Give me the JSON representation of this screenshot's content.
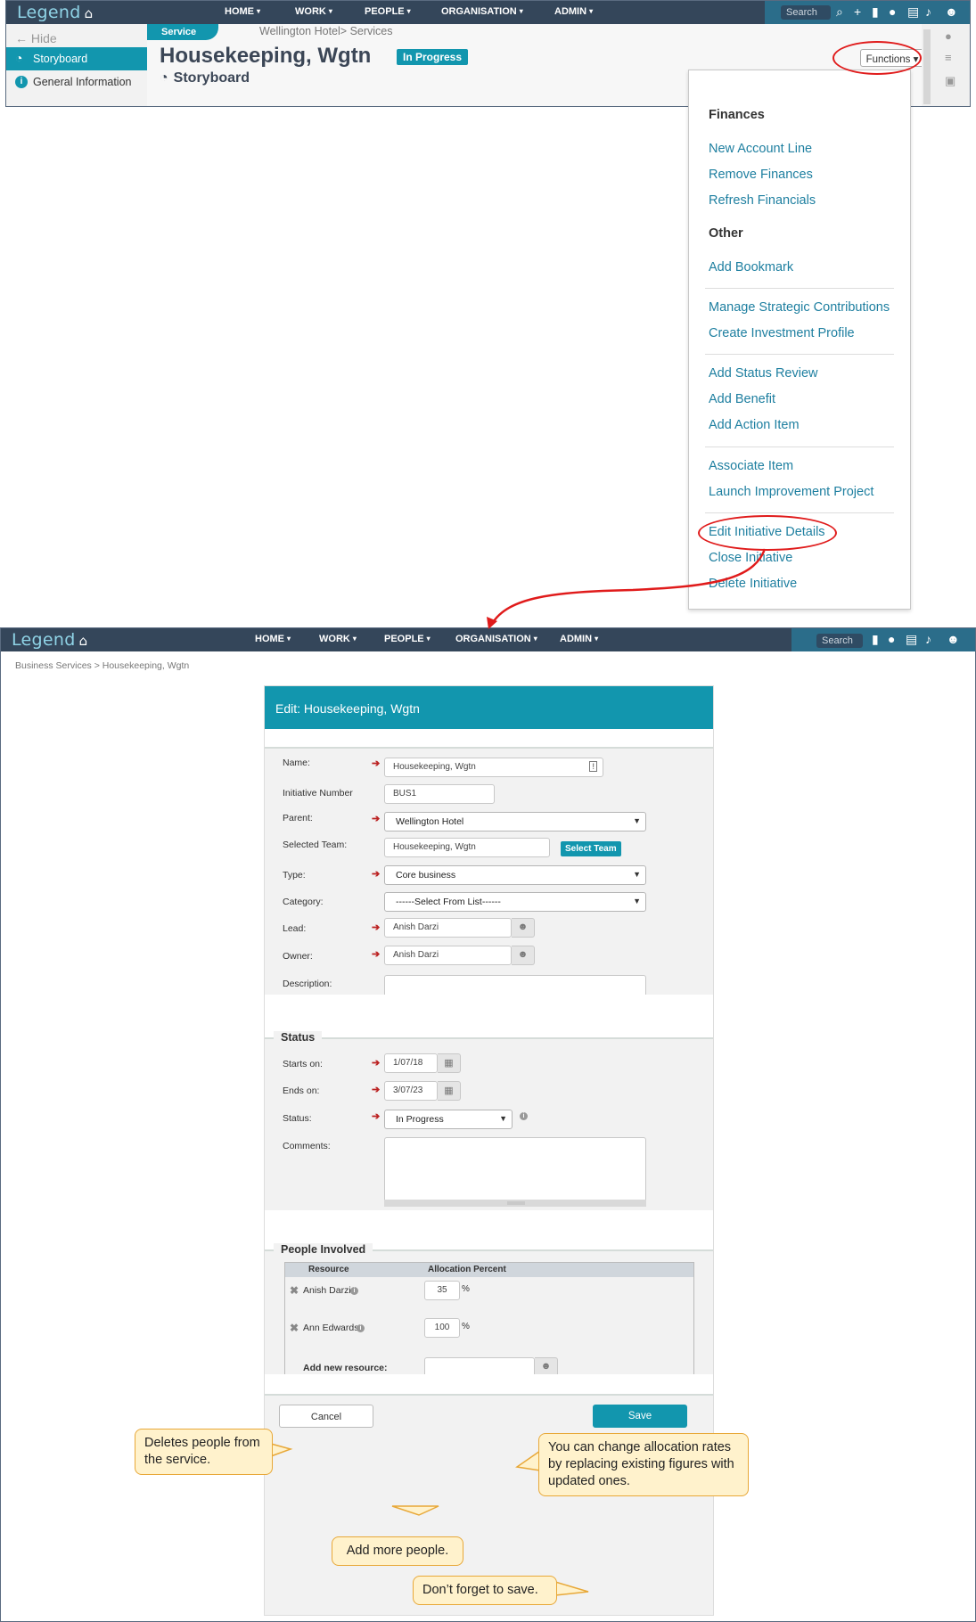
{
  "top": {
    "logo": "Legend",
    "nav": [
      "HOME",
      "WORK",
      "PEOPLE",
      "ORGANISATION",
      "ADMIN"
    ],
    "search_placeholder": "Search",
    "sidebar": {
      "hide": "Hide",
      "items": [
        "Storyboard",
        "General Information"
      ]
    },
    "service_tab": "Service",
    "breadcrumb": "Wellington Hotel> Services",
    "title": "Housekeeping, Wgtn",
    "status_badge": "In Progress",
    "subtitle": "Storyboard",
    "functions_button": "Functions"
  },
  "functions_menu": {
    "finances_heading": "Finances",
    "finances_items": [
      "New Account Line",
      "Remove Finances",
      "Refresh Financials"
    ],
    "other_heading": "Other",
    "other_items": [
      "Add Bookmark",
      "Manage Strategic Contributions",
      "Create Investment Profile",
      "Add Status Review",
      "Add Benefit",
      "Add Action Item",
      "Associate Item",
      "Launch Improvement Project",
      "Edit Initiative Details",
      "Close Initiative",
      "Delete Initiative"
    ]
  },
  "bottom": {
    "logo": "Legend",
    "nav": [
      "HOME",
      "WORK",
      "PEOPLE",
      "ORGANISATION",
      "ADMIN"
    ],
    "search_placeholder": "Search",
    "breadcrumb": "Business Services > Housekeeping, Wgtn",
    "form": {
      "header": "Edit: Housekeeping, Wgtn",
      "name_label": "Name:",
      "name_value": "Housekeeping, Wgtn",
      "number_label": "Initiative Number",
      "number_value": "BUS1",
      "parent_label": "Parent:",
      "parent_value": "Wellington Hotel",
      "team_label": "Selected Team:",
      "team_value": "Housekeeping, Wgtn",
      "select_team_button": "Select Team",
      "type_label": "Type:",
      "type_value": "Core business",
      "category_label": "Category:",
      "category_value": "------Select From List------",
      "lead_label": "Lead:",
      "lead_value": "Anish Darzi",
      "owner_label": "Owner:",
      "owner_value": "Anish Darzi",
      "description_label": "Description:",
      "status_section": "Status",
      "starts_label": "Starts on:",
      "starts_value": "1/07/18",
      "ends_label": "Ends on:",
      "ends_value": "3/07/23",
      "status_label": "Status:",
      "status_value": "In Progress",
      "comments_label": "Comments:",
      "people_section": "People Involved",
      "resource_header": "Resource",
      "allocation_header": "Allocation Percent",
      "people": [
        {
          "name": "Anish Darzi",
          "allocation": "35"
        },
        {
          "name": "Ann Edwards",
          "allocation": "100"
        }
      ],
      "percent_sign": "%",
      "add_resource_label": "Add new resource:",
      "cancel_button": "Cancel",
      "save_button": "Save"
    }
  },
  "callouts": {
    "delete_people": "Deletes people from the service.",
    "allocation": "You can change allocation rates by replacing existing figures with updated ones.",
    "add_people": "Add more people.",
    "save_reminder": "Don’t forget to save."
  },
  "colors": {
    "nav": "#34465a",
    "accent": "#1296ae",
    "link": "#1e7fa0",
    "highlight": "#e01b1b",
    "callout_bg": "#fff2cc"
  }
}
